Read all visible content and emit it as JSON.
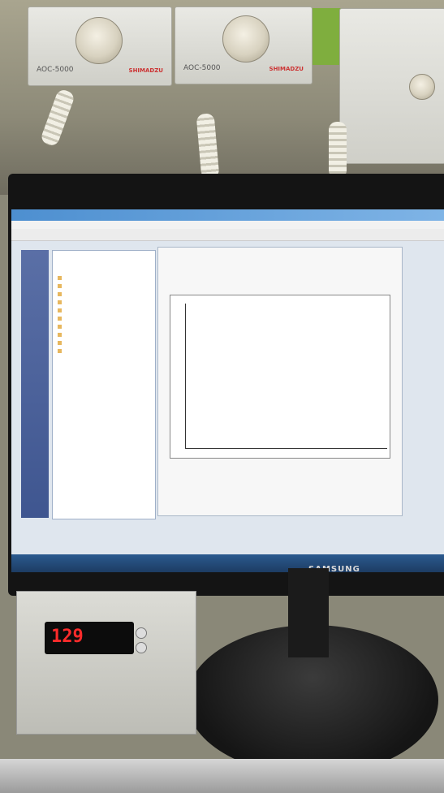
{
  "autosamplers": [
    {
      "label": "AOC-5000",
      "brand": "SHIMADZU"
    },
    {
      "label": "AOC-5000",
      "brand": "SHIMADZU"
    }
  ],
  "monitor": {
    "brand": "SAMSUNG"
  },
  "controller": {
    "display_value": "129"
  }
}
